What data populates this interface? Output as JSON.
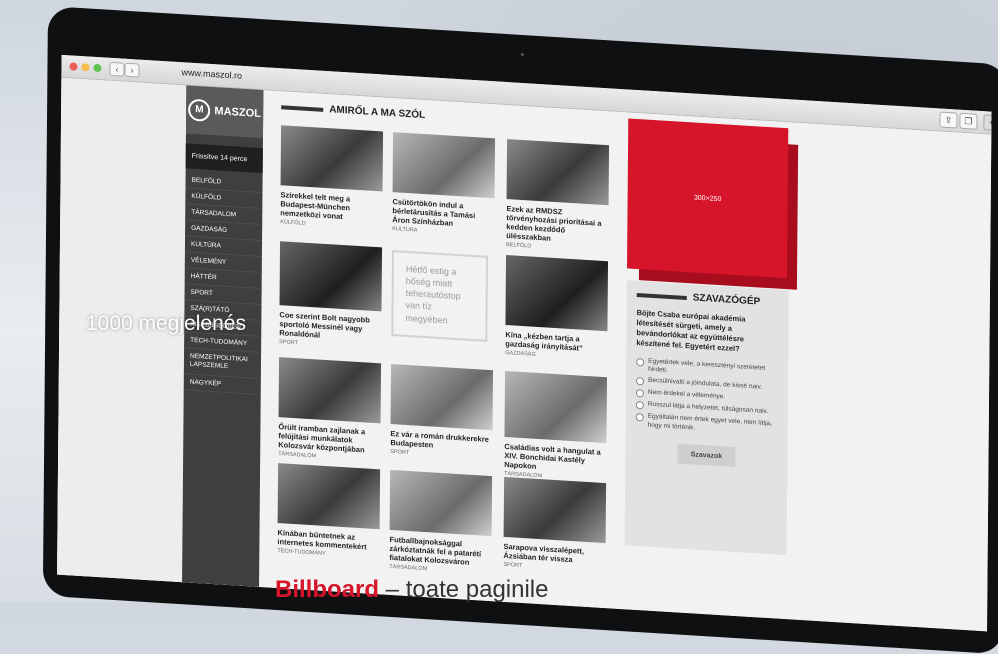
{
  "browser": {
    "url": "www.maszol.ro"
  },
  "site": {
    "logo_text": "MASZOL",
    "logo_mark": "M",
    "fresh_label": "Frissítve",
    "fresh_time": "14 perce",
    "menu": [
      "Belföld",
      "Külföld",
      "Társadalom",
      "Gazdaság",
      "Kultúra",
      "Vélemény",
      "Háttér",
      "Sport",
      "Szá(r)tátó",
      "Kisebbségben",
      "Tech-tudomány",
      "Nemzetpolitikai lapszemle",
      "Nagykép"
    ],
    "section_title": "AMIRŐL A MA SZÓL"
  },
  "articles": [
    {
      "title": "Szírekkel telt meg a Budapest-München nemzetközi vonat",
      "category": "KÜLFÖLD"
    },
    {
      "title": "Csütörtökön indul a bérletárusítás a Tamási Áron Színházban",
      "category": "KULTÚRA"
    },
    {
      "title": "Ezek az RMDSZ törvényhozási prioritásai a kedden kezdődő ülésszakban",
      "category": "BELFÖLD"
    },
    {
      "title": "Coe szerint Bolt nagyobb sportoló Messinél vagy Ronaldónál",
      "category": "SPORT"
    },
    {
      "title": "Kína „kézben tartja a gazdaság irányítását”",
      "category": "GAZDASÁG"
    },
    {
      "title": "Őrült iramban zajlanak a felújítási munkálatok Kolozsvár központjában",
      "category": "TÁRSADALOM"
    },
    {
      "title": "Ez vár a román drukkerekre Budapesten",
      "category": "SPORT"
    },
    {
      "title": "Családias volt a hangulat a XIV. Bonchidai Kastély Napokon",
      "category": "TÁRSADALOM"
    },
    {
      "title": "Kínában büntetnek az internetes kommentekért",
      "category": "TECH-TUDOMÁNY"
    },
    {
      "title": "Futballbajnoksággal zárkóztatnák fel a patarétí fiatalokat Kolozsváron",
      "category": "TÁRSADALOM"
    },
    {
      "title": "Sarapova visszalépett, Ázsiában tér vissza",
      "category": "SPORT"
    }
  ],
  "quote": "Hétfő estig a hőség miatt teherautóstop van tíz megyében",
  "ad": {
    "label": "300×250"
  },
  "poll": {
    "title": "SZAVAZÓGÉP",
    "question": "Böjte Csaba európai akadémia létesítését sürgeti, amely a bevándorlókat az együttélésre készítené fel. Egyetért ezzel?",
    "options": [
      "Egyetértek vele, a keresztényi szeretetet hirdeti.",
      "Becsülnivaló a jóindulata, de kissé naiv.",
      "Nem érdekel a véleménye.",
      "Rosszul látja a helyzetet, túlságosan naiv.",
      "Egyáltalán nem értek egyet vele, nem látja, hogy mi történik."
    ],
    "button": "Szavazok"
  },
  "overlay_text": "1000 megjelenés",
  "caption": {
    "highlight": "Billboard",
    "rest": " – toate paginile"
  }
}
